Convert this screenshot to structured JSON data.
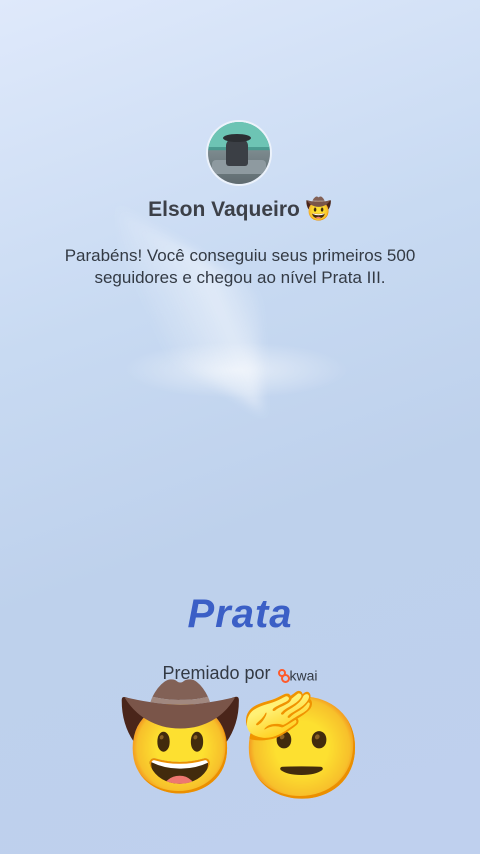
{
  "profile": {
    "name": "Elson Vaqueiro 🤠",
    "avatar_icon": "profile-photo"
  },
  "message": "Parabéns! Você conseguiu seus primeiros 500 seguidores e chegou ao nível Prata III.",
  "level": {
    "label": "Prata",
    "color": "#3b5fc6"
  },
  "award": {
    "text": "Premiado por",
    "brand": "kwai",
    "brand_color": "#ff5a2a"
  },
  "emojis": {
    "first": "🤠",
    "second": "🫡"
  }
}
